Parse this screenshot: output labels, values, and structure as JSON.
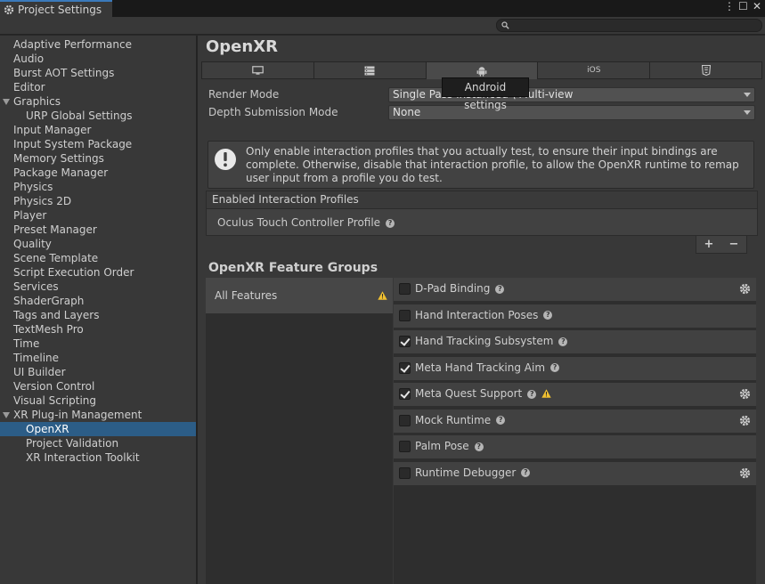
{
  "window": {
    "title": "Project Settings",
    "controls": [
      "⋮",
      "☐",
      "✕"
    ]
  },
  "search": {
    "placeholder": "",
    "value": ""
  },
  "sidebar": {
    "items": [
      {
        "label": "Adaptive Performance",
        "level": 0
      },
      {
        "label": "Audio",
        "level": 0
      },
      {
        "label": "Burst AOT Settings",
        "level": 0
      },
      {
        "label": "Editor",
        "level": 0
      },
      {
        "label": "Graphics",
        "level": 0,
        "expanded": true
      },
      {
        "label": "URP Global Settings",
        "level": 1
      },
      {
        "label": "Input Manager",
        "level": 0
      },
      {
        "label": "Input System Package",
        "level": 0
      },
      {
        "label": "Memory Settings",
        "level": 0
      },
      {
        "label": "Package Manager",
        "level": 0
      },
      {
        "label": "Physics",
        "level": 0
      },
      {
        "label": "Physics 2D",
        "level": 0
      },
      {
        "label": "Player",
        "level": 0
      },
      {
        "label": "Preset Manager",
        "level": 0
      },
      {
        "label": "Quality",
        "level": 0
      },
      {
        "label": "Scene Template",
        "level": 0
      },
      {
        "label": "Script Execution Order",
        "level": 0
      },
      {
        "label": "Services",
        "level": 0
      },
      {
        "label": "ShaderGraph",
        "level": 0
      },
      {
        "label": "Tags and Layers",
        "level": 0
      },
      {
        "label": "TextMesh Pro",
        "level": 0
      },
      {
        "label": "Time",
        "level": 0
      },
      {
        "label": "Timeline",
        "level": 0
      },
      {
        "label": "UI Builder",
        "level": 0
      },
      {
        "label": "Version Control",
        "level": 0
      },
      {
        "label": "Visual Scripting",
        "level": 0
      },
      {
        "label": "XR Plug-in Management",
        "level": 0,
        "expanded": true
      },
      {
        "label": "OpenXR",
        "level": 1,
        "selected": true
      },
      {
        "label": "Project Validation",
        "level": 1
      },
      {
        "label": "XR Interaction Toolkit",
        "level": 1
      }
    ]
  },
  "main": {
    "title": "OpenXR",
    "tabs": [
      {
        "icon": "monitor-icon"
      },
      {
        "icon": "server-icon"
      },
      {
        "icon": "android-icon",
        "active": true
      },
      {
        "label": "iOS"
      },
      {
        "icon": "html5-icon"
      }
    ],
    "tooltip": "Android settings",
    "render_mode": {
      "label": "Render Mode",
      "value": "Single Pass Instanced \\ Multi-view"
    },
    "depth_mode": {
      "label": "Depth Submission Mode",
      "value": "None"
    },
    "help_text": "Only enable interaction profiles that you actually test, to ensure their input bindings are complete. Otherwise, disable that interaction profile, to allow the OpenXR runtime to remap user input from a profile you do test.",
    "profiles": {
      "header": "Enabled Interaction Profiles",
      "items": [
        "Oculus Touch Controller Profile"
      ],
      "add": "+",
      "remove": "−"
    },
    "feature_groups_title": "OpenXR Feature Groups",
    "groups": [
      {
        "label": "All Features",
        "warning": true
      }
    ],
    "features": [
      {
        "name": "D-Pad Binding",
        "checked": false,
        "gear": true,
        "warning": false
      },
      {
        "name": "Hand Interaction Poses",
        "checked": false,
        "gear": false,
        "warning": false
      },
      {
        "name": "Hand Tracking Subsystem",
        "checked": true,
        "gear": false,
        "warning": false
      },
      {
        "name": "Meta Hand Tracking Aim",
        "checked": true,
        "gear": false,
        "warning": false
      },
      {
        "name": "Meta Quest Support",
        "checked": true,
        "gear": true,
        "warning": true
      },
      {
        "name": "Mock Runtime",
        "checked": false,
        "gear": true,
        "warning": false
      },
      {
        "name": "Palm Pose",
        "checked": false,
        "gear": false,
        "warning": false
      },
      {
        "name": "Runtime Debugger",
        "checked": false,
        "gear": true,
        "warning": false
      }
    ]
  },
  "colors": {
    "selection": "#2c5d87",
    "warning": "#f0c030",
    "panel": "#383838"
  }
}
